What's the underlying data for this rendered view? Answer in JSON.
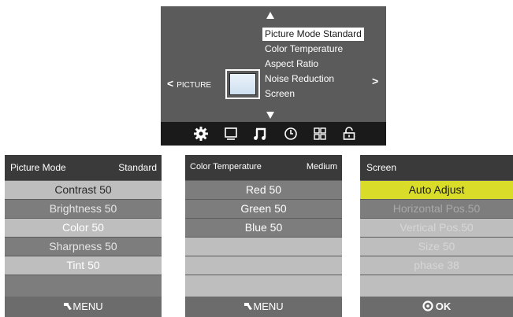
{
  "osd": {
    "nav_left_arrow": "<",
    "section_label": "PICTURE",
    "nav_right_arrow": ">",
    "menu_items": [
      "Picture Mode Standard",
      "Color Temperature",
      "Aspect Ratio",
      "Noise Reduction",
      "Screen"
    ],
    "icons": [
      "gear-icon",
      "monitor-icon",
      "music-note-icon",
      "clock-icon",
      "grid-icon",
      "lock-icon"
    ]
  },
  "picture_panel": {
    "title": "Picture Mode",
    "value": "Standard",
    "rows": [
      "Contrast 50",
      "Brightness 50",
      "Color 50",
      "Sharpness 50",
      "Tint 50"
    ],
    "footer": "MENU"
  },
  "color_panel": {
    "title": "Color Temperature",
    "value": "Medium",
    "rows": [
      "Red 50",
      "Green 50",
      "Blue 50"
    ],
    "footer": "MENU"
  },
  "screen_panel": {
    "title": "Screen",
    "rows": [
      "Auto Adjust",
      "Horizontal Pos.50",
      "Vertical Pos.50",
      "Size 50",
      "phase 38"
    ],
    "footer": "OK"
  },
  "colors": {
    "highlight": "#d9dd2a",
    "panel_bg": "#5b5b5b",
    "header_bg": "#3a3a3a"
  }
}
